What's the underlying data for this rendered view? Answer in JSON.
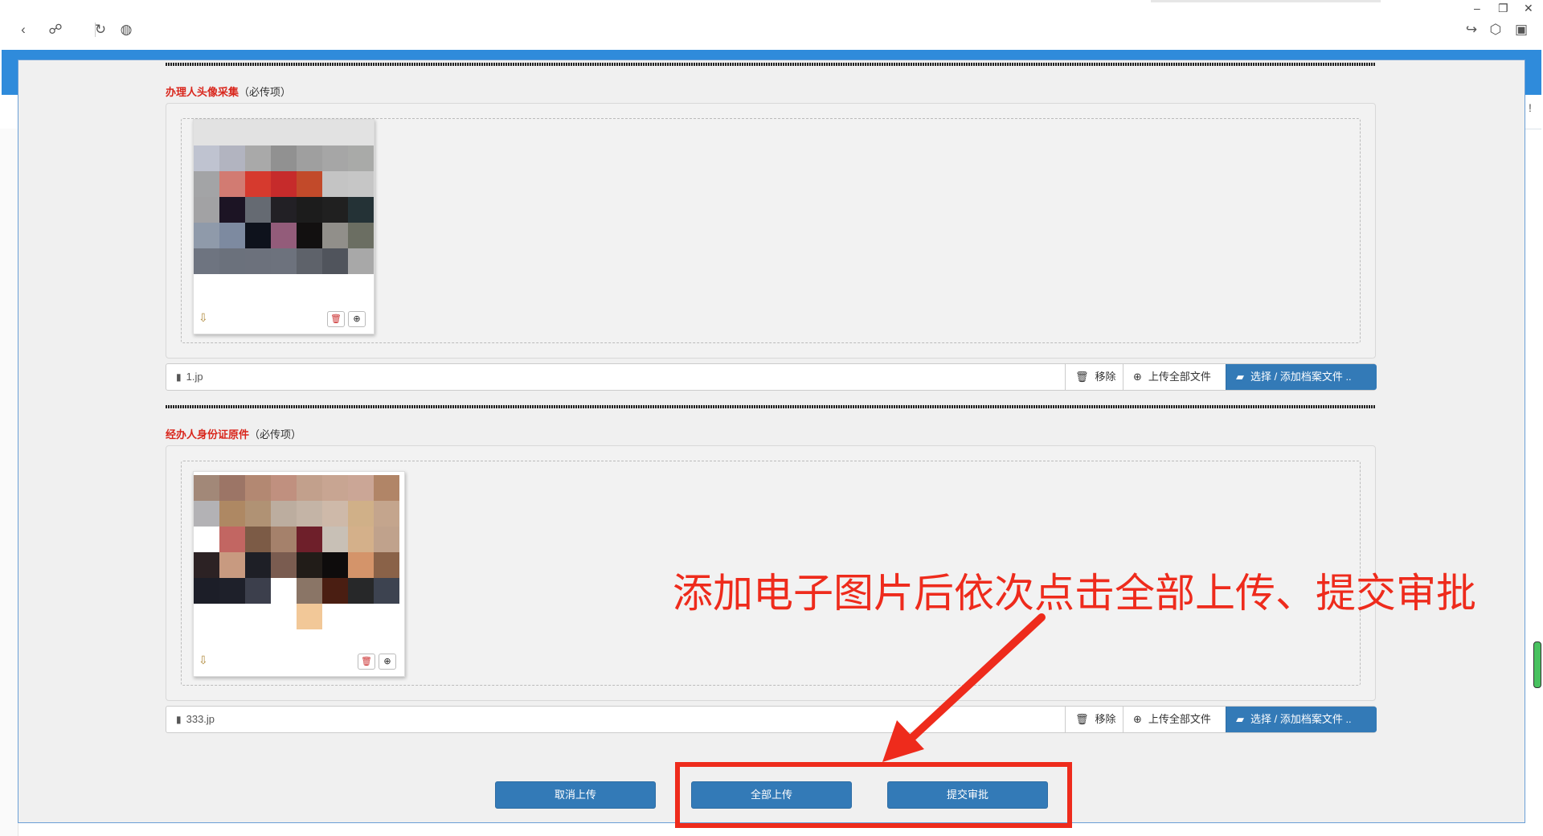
{
  "browser": {
    "back_icon": "chevron-left-icon",
    "link_icon": "link-icon",
    "refresh_icon": "refresh-icon",
    "globe_icon": "globe-icon",
    "minimize": "–",
    "restore": "❐",
    "close": "✕"
  },
  "background": {
    "exclamation": "!"
  },
  "sections": [
    {
      "title": "办理人头像采集",
      "note": "（必传项）",
      "file_name": "1.jp"
    },
    {
      "title": "经办人身份证原件",
      "note": "（必传项）",
      "file_name": "333.jp"
    }
  ],
  "file_actions": {
    "remove_label": "移除",
    "upload_all_label": "上传全部文件",
    "choose_label": "选择 / 添加档案文件 .."
  },
  "buttons": {
    "cancel": "取消上传",
    "upload_all": "全部上传",
    "submit": "提交审批"
  },
  "annotation": {
    "text": "添加电子图片后依次点击全部上传、提交审批",
    "color": "#ee2b1c"
  },
  "colors": {
    "primary": "#337ab7",
    "required": "#d9261c",
    "top_bar": "#2f8bdb"
  }
}
